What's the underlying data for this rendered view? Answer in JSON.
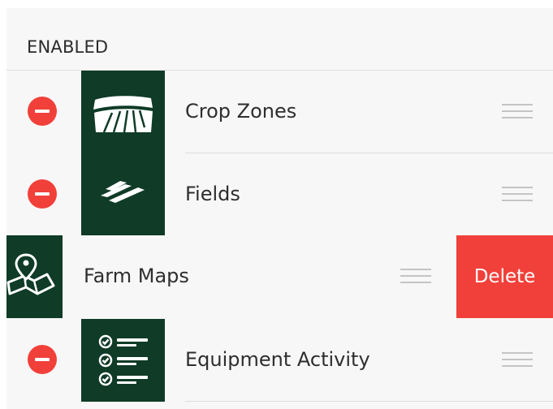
{
  "section": {
    "title": "ENABLED"
  },
  "colors": {
    "tile": "#0f3b27",
    "danger": "#f1403a",
    "background": "#f7f7f7"
  },
  "rows": [
    {
      "label": "Crop Zones",
      "icon": "crop-zones-icon"
    },
    {
      "label": "Fields",
      "icon": "fields-icon"
    },
    {
      "label": "Farm Maps",
      "icon": "farm-maps-icon",
      "swiped": true,
      "action_label": "Delete"
    },
    {
      "label": "Equipment Activity",
      "icon": "equipment-activity-icon"
    }
  ]
}
